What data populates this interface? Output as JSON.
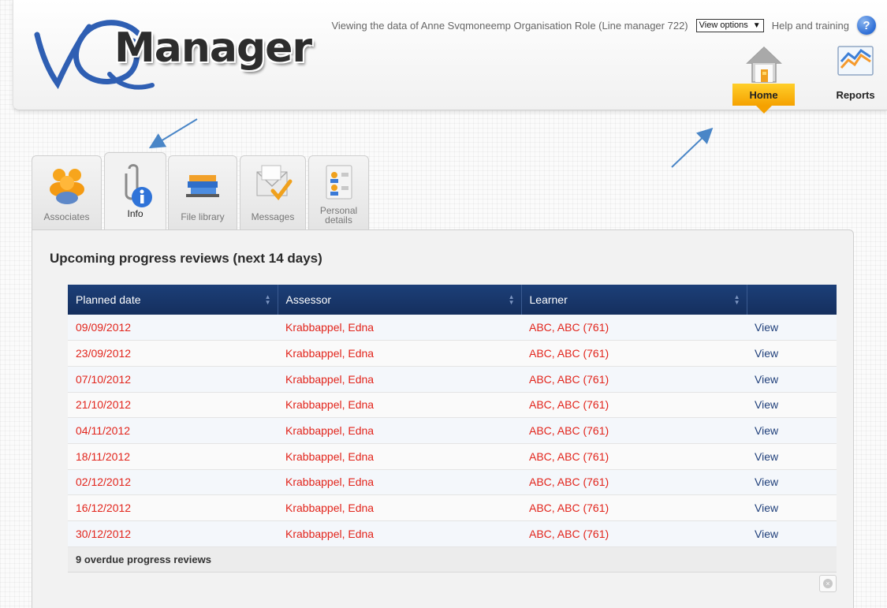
{
  "app": {
    "logo_text": "Manager",
    "viewing_text": "Viewing the data of Anne Svqmoneemp Organisation Role (Line manager 722)",
    "view_options": "View options",
    "help_text": "Help and training",
    "help_glyph": "?"
  },
  "nav": {
    "home_label": "Home",
    "reports_label": "Reports",
    "active": "Home",
    "accent_color": "#f5a100"
  },
  "tabs": [
    {
      "label": "Associates",
      "icon": "associates-icon"
    },
    {
      "label": "Info",
      "icon": "info-icon",
      "active": true
    },
    {
      "label": "File library",
      "icon": "file-library-icon"
    },
    {
      "label": "Messages",
      "icon": "messages-icon"
    },
    {
      "label": "Personal details",
      "icon": "personal-details-icon"
    }
  ],
  "reviews": {
    "title": "Upcoming progress reviews (next 14 days)",
    "columns": [
      "Planned date",
      "Assessor",
      "Learner",
      ""
    ],
    "rows": [
      {
        "date": "09/09/2012",
        "assessor": "Krabbappel, Edna",
        "learner": "ABC, ABC (761)",
        "action": "View"
      },
      {
        "date": "23/09/2012",
        "assessor": "Krabbappel, Edna",
        "learner": "ABC, ABC (761)",
        "action": "View"
      },
      {
        "date": "07/10/2012",
        "assessor": "Krabbappel, Edna",
        "learner": "ABC, ABC (761)",
        "action": "View"
      },
      {
        "date": "21/10/2012",
        "assessor": "Krabbappel, Edna",
        "learner": "ABC, ABC (761)",
        "action": "View"
      },
      {
        "date": "04/11/2012",
        "assessor": "Krabbappel, Edna",
        "learner": "ABC, ABC (761)",
        "action": "View"
      },
      {
        "date": "18/11/2012",
        "assessor": "Krabbappel, Edna",
        "learner": "ABC, ABC (761)",
        "action": "View"
      },
      {
        "date": "02/12/2012",
        "assessor": "Krabbappel, Edna",
        "learner": "ABC, ABC (761)",
        "action": "View"
      },
      {
        "date": "16/12/2012",
        "assessor": "Krabbappel, Edna",
        "learner": "ABC, ABC (761)",
        "action": "View"
      },
      {
        "date": "30/12/2012",
        "assessor": "Krabbappel, Edna",
        "learner": "ABC, ABC (761)",
        "action": "View"
      }
    ],
    "footer": "9 overdue progress reviews",
    "overdue_color": "#e2241b",
    "header_color": "#1c3f78"
  }
}
